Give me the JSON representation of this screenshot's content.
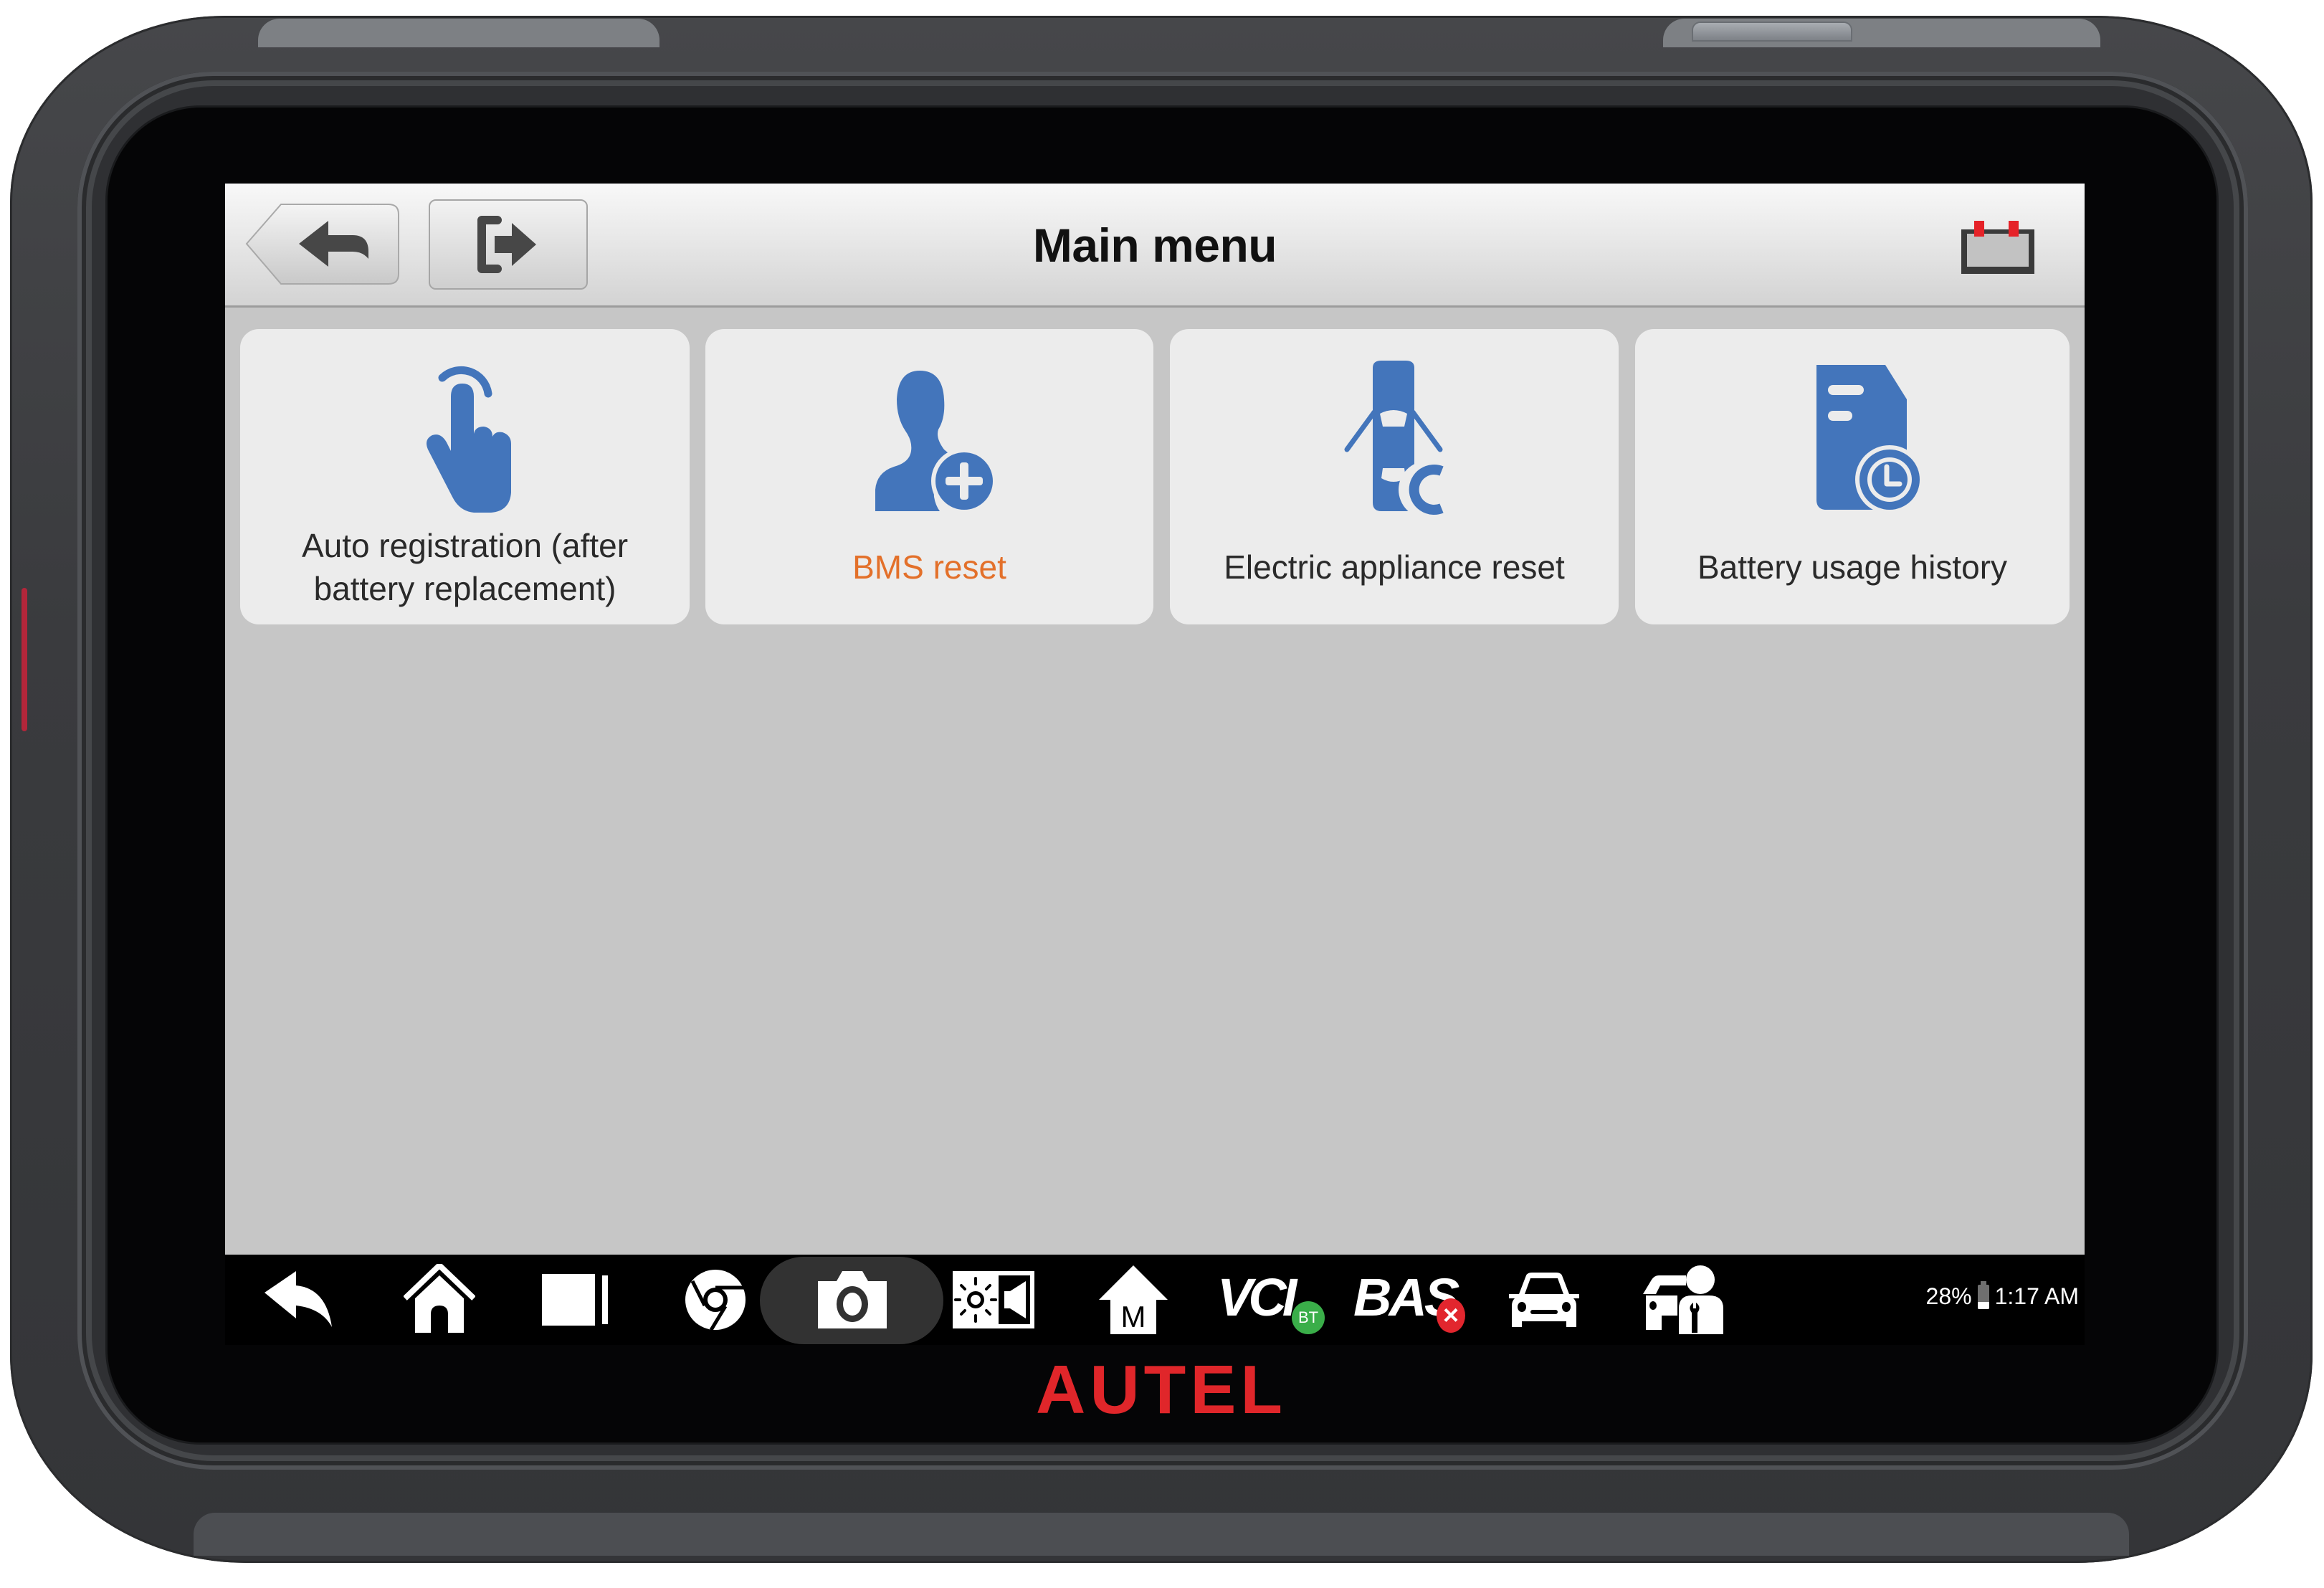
{
  "device": {
    "brand_logo": "AUTEL",
    "brand_color": "#e0262a"
  },
  "header": {
    "title": "Main menu",
    "back_icon": "back-arrow-icon",
    "exit_icon": "exit-icon",
    "status_icon": "vehicle-battery-icon"
  },
  "menu": {
    "active_color": "#e3702a",
    "icon_color": "#4375bb",
    "items": [
      {
        "label": "Auto registration (after battery replacement)",
        "icon": "touch-hand-icon",
        "active": false
      },
      {
        "label": "BMS reset",
        "icon": "user-add-icon",
        "active": true
      },
      {
        "label": "Electric appliance reset",
        "icon": "car-doors-reset-icon",
        "active": false
      },
      {
        "label": "Battery usage history",
        "icon": "document-clock-icon",
        "active": false
      }
    ]
  },
  "navbar": {
    "items": [
      {
        "name": "back",
        "icon": "back-icon"
      },
      {
        "name": "home",
        "icon": "home-icon"
      },
      {
        "name": "recent-apps",
        "icon": "recent-apps-icon"
      },
      {
        "name": "browser",
        "icon": "chrome-icon"
      },
      {
        "name": "screenshot",
        "icon": "camera-icon",
        "selected": true
      },
      {
        "name": "display-sound",
        "icon": "brightness-volume-icon"
      },
      {
        "name": "maxifix-home",
        "icon": "m-home-icon",
        "badge_text": "M"
      },
      {
        "name": "vci",
        "icon": "vci-icon",
        "text": "VCI",
        "badge_text": "BT",
        "badge_color": "#3aae49"
      },
      {
        "name": "bas",
        "icon": "bas-icon",
        "text": "BAS",
        "badge_text": "×",
        "badge_color": "#e2262e"
      },
      {
        "name": "vehicle",
        "icon": "car-icon"
      },
      {
        "name": "remote-expert",
        "icon": "technician-icon"
      }
    ],
    "status": {
      "battery_percent_label": "28%",
      "battery_level": 0.28,
      "time": "1:17 AM"
    }
  }
}
